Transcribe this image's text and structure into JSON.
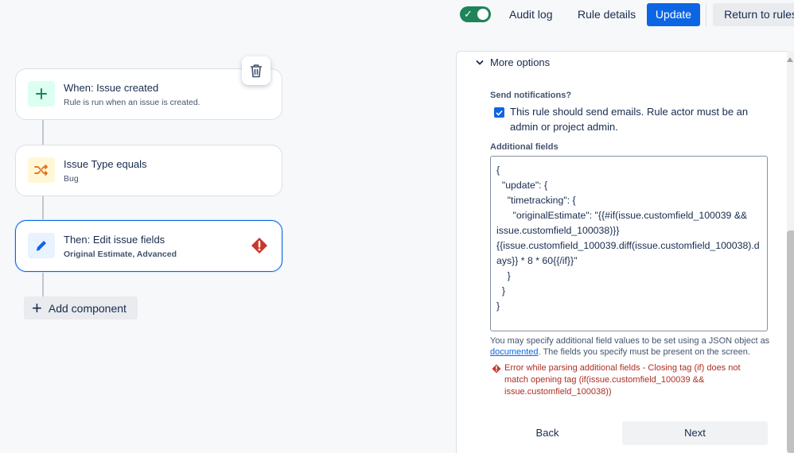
{
  "header": {
    "audit_log": "Audit log",
    "rule_details": "Rule details",
    "update": "Update",
    "return_to_rules": "Return to rules"
  },
  "flow": {
    "trigger": {
      "title": "When: Issue created",
      "subtitle": "Rule is run when an issue is created."
    },
    "condition": {
      "title": "Issue Type equals",
      "subtitle": "Bug"
    },
    "action": {
      "title": "Then: Edit issue fields",
      "subtitle": "Original Estimate, Advanced"
    },
    "add_component": "Add component"
  },
  "panel": {
    "more_options": "More options",
    "send_notifications_label": "Send notifications?",
    "send_notifications_text": "This rule should send emails. Rule actor must be an admin or project admin.",
    "additional_fields_label": "Additional fields",
    "additional_fields_value": "{\n  \"update\": {\n    \"timetracking\": {\n      \"originalEstimate\": \"{{#if(issue.customfield_100039 && issue.customfield_100038)}}{{issue.customfield_100039.diff(issue.customfield_100038).days}} * 8 * 60{{/if}}\"\n    }\n  }\n}",
    "help_prefix": "You may specify additional field values to be set using a JSON object as ",
    "help_link": "documented",
    "help_suffix": ". The fields you specify must be present on the screen.",
    "error": "Error while parsing additional fields - Closing tag (if) does not match opening tag (if(issue.customfield_100039 && issue.customfield_100038))",
    "back": "Back",
    "next": "Next"
  },
  "colors": {
    "primary": "#0c66e4",
    "toggle_on": "#1f845a",
    "error": "#ae2e24",
    "trigger_icon_bg": "#dcfff1",
    "condition_icon_bg": "#fff7d6",
    "action_icon_bg": "#e9f2ff"
  },
  "icons": {
    "toggle": "check-icon",
    "trash": "trash-icon",
    "trigger": "plus-icon",
    "condition": "shuffle-icon",
    "action": "pencil-icon",
    "warning": "warning-diamond-icon",
    "more_options": "chevron-down-icon",
    "add_component": "plus-icon"
  }
}
